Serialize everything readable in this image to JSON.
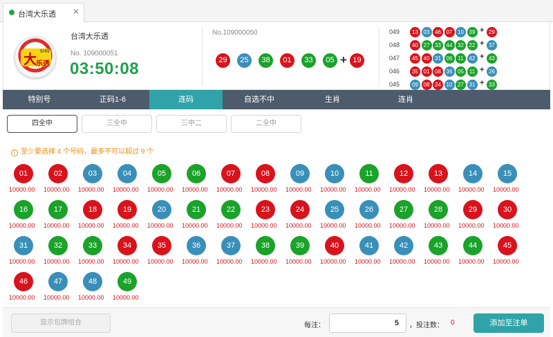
{
  "tab": {
    "title": "台湾大乐透",
    "close": "✕"
  },
  "header": {
    "lottery_name": "台湾大乐透",
    "logo": {
      "big": "大",
      "small": "乐透",
      "num": "6/49"
    },
    "current_issue": "No. 109000051",
    "countdown": "03:50:08",
    "last_issue": "No.109000050",
    "last_balls": [
      {
        "n": "29",
        "c": "red"
      },
      {
        "n": "25",
        "c": "blue"
      },
      {
        "n": "38",
        "c": "green"
      },
      {
        "n": "01",
        "c": "red"
      },
      {
        "n": "33",
        "c": "green"
      },
      {
        "n": "05",
        "c": "green"
      }
    ],
    "last_special": {
      "n": "19",
      "c": "red"
    },
    "plus": "+"
  },
  "history": [
    {
      "issue": "049",
      "balls": [
        [
          "13",
          "red"
        ],
        [
          "03",
          "blue"
        ],
        [
          "46",
          "red"
        ],
        [
          "07",
          "red"
        ],
        [
          "10",
          "blue"
        ],
        [
          "39",
          "green"
        ]
      ],
      "special": [
        "29",
        "red"
      ]
    },
    {
      "issue": "048",
      "balls": [
        [
          "40",
          "red"
        ],
        [
          "27",
          "green"
        ],
        [
          "33",
          "green"
        ],
        [
          "44",
          "green"
        ],
        [
          "32",
          "green"
        ],
        [
          "22",
          "green"
        ]
      ],
      "special": [
        "37",
        "blue"
      ]
    },
    {
      "issue": "047",
      "balls": [
        [
          "45",
          "red"
        ],
        [
          "40",
          "red"
        ],
        [
          "31",
          "blue"
        ],
        [
          "06",
          "green"
        ],
        [
          "11",
          "green"
        ],
        [
          "42",
          "blue"
        ]
      ],
      "special": [
        "43",
        "green"
      ]
    },
    {
      "issue": "046",
      "balls": [
        [
          "35",
          "red"
        ],
        [
          "01",
          "red"
        ],
        [
          "08",
          "red"
        ],
        [
          "36",
          "blue"
        ],
        [
          "05",
          "green"
        ],
        [
          "11",
          "green"
        ]
      ],
      "special": [
        "26",
        "blue"
      ]
    },
    {
      "issue": "045",
      "balls": [
        [
          "09",
          "blue"
        ],
        [
          "08",
          "red"
        ],
        [
          "24",
          "red"
        ],
        [
          "10",
          "blue"
        ],
        [
          "27",
          "green"
        ],
        [
          "31",
          "blue"
        ]
      ],
      "special": [
        "33",
        "green"
      ]
    }
  ],
  "nav": [
    "特别号",
    "正码1-6",
    "连码",
    "自选不中",
    "生肖",
    "连肖"
  ],
  "nav_active": 2,
  "subtabs": [
    "四全中",
    "三全中",
    "三中二",
    "二全中"
  ],
  "sub_active": 0,
  "hint": {
    "icon": "i",
    "text": "至少要选择 4 个号码，最多不可以超过 9 个"
  },
  "odds": "10000.00",
  "balls": [
    [
      "01",
      "red"
    ],
    [
      "02",
      "red"
    ],
    [
      "03",
      "blue"
    ],
    [
      "04",
      "blue"
    ],
    [
      "05",
      "green"
    ],
    [
      "06",
      "green"
    ],
    [
      "07",
      "red"
    ],
    [
      "08",
      "red"
    ],
    [
      "09",
      "blue"
    ],
    [
      "10",
      "blue"
    ],
    [
      "11",
      "green"
    ],
    [
      "12",
      "red"
    ],
    [
      "13",
      "red"
    ],
    [
      "14",
      "blue"
    ],
    [
      "15",
      "blue"
    ],
    [
      "16",
      "green"
    ],
    [
      "17",
      "green"
    ],
    [
      "18",
      "red"
    ],
    [
      "19",
      "red"
    ],
    [
      "20",
      "blue"
    ],
    [
      "21",
      "green"
    ],
    [
      "22",
      "green"
    ],
    [
      "23",
      "red"
    ],
    [
      "24",
      "red"
    ],
    [
      "25",
      "blue"
    ],
    [
      "26",
      "blue"
    ],
    [
      "27",
      "green"
    ],
    [
      "28",
      "green"
    ],
    [
      "29",
      "red"
    ],
    [
      "30",
      "red"
    ],
    [
      "31",
      "blue"
    ],
    [
      "32",
      "green"
    ],
    [
      "33",
      "green"
    ],
    [
      "34",
      "red"
    ],
    [
      "35",
      "red"
    ],
    [
      "36",
      "blue"
    ],
    [
      "37",
      "blue"
    ],
    [
      "38",
      "green"
    ],
    [
      "39",
      "green"
    ],
    [
      "40",
      "red"
    ],
    [
      "41",
      "blue"
    ],
    [
      "42",
      "blue"
    ],
    [
      "43",
      "green"
    ],
    [
      "44",
      "green"
    ],
    [
      "45",
      "red"
    ],
    [
      "46",
      "red"
    ],
    [
      "47",
      "blue"
    ],
    [
      "48",
      "blue"
    ],
    [
      "49",
      "green"
    ]
  ],
  "footer": {
    "combo_button": "显示包牌组合",
    "per_label": "每注：",
    "amount": "5",
    "count_label": "，投注数：",
    "count_value": "0",
    "add_button": "添加至注单"
  }
}
